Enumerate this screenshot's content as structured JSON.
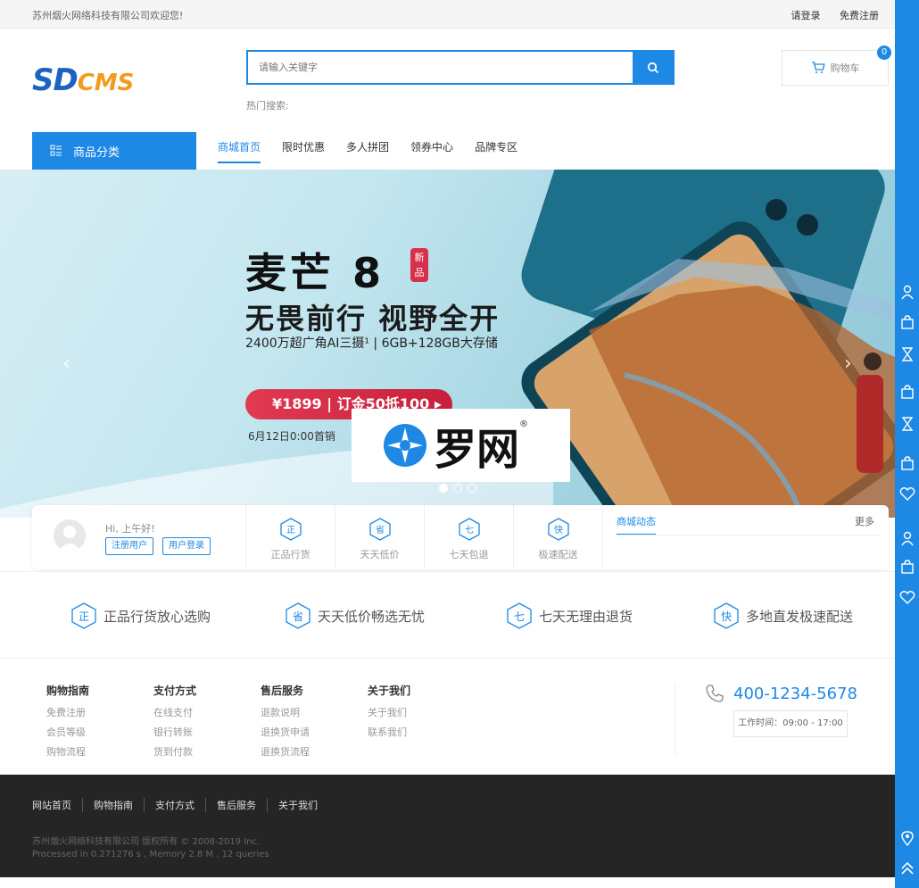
{
  "topbar": {
    "welcome": "苏州烟火网络科技有限公司欢迎您!",
    "login": "请登录",
    "register": "免费注册"
  },
  "logo": {
    "sd": "SD",
    "cms": "CMS"
  },
  "search": {
    "placeholder": "请输入关键字",
    "hot_label": "热门搜索:"
  },
  "cart": {
    "label": "购物车",
    "count": "0"
  },
  "category_button": "商品分类",
  "nav": [
    {
      "label": "商城首页",
      "active": true
    },
    {
      "label": "限时优惠"
    },
    {
      "label": "多人拼团"
    },
    {
      "label": "领券中心"
    },
    {
      "label": "品牌专区"
    }
  ],
  "banner": {
    "title": "麦芒 8",
    "new_badge": "新品",
    "subtitle": "无畏前行 视野全开",
    "spec": "2400万超广角AI三摄¹ | 6GB+128GB大存储",
    "price": "¥1899 | 订金50抵100 ▸",
    "date": "6月12日0:00首销"
  },
  "watermark": {
    "text": "罗网",
    "reg": "®"
  },
  "user_panel": {
    "greeting": "Hi, 上午好!",
    "register_btn": "注册用户",
    "login_btn": "用户登录"
  },
  "features": [
    {
      "icon": "正",
      "label": "正品行货"
    },
    {
      "icon": "省",
      "label": "天天低价"
    },
    {
      "icon": "七",
      "label": "七天包退"
    },
    {
      "icon": "快",
      "label": "极速配送"
    }
  ],
  "news": {
    "tab": "商城动态",
    "more": "更多"
  },
  "guarantees": [
    {
      "icon": "正",
      "text": "正品行货放心选购"
    },
    {
      "icon": "省",
      "text": "天天低价畅选无忧"
    },
    {
      "icon": "七",
      "text": "七天无理由退货"
    },
    {
      "icon": "快",
      "text": "多地直发极速配送"
    }
  ],
  "footer_cols": [
    {
      "title": "购物指南",
      "links": [
        "免费注册",
        "会员等级",
        "购物流程"
      ]
    },
    {
      "title": "支付方式",
      "links": [
        "在线支付",
        "银行转账",
        "货到付款"
      ]
    },
    {
      "title": "售后服务",
      "links": [
        "退款说明",
        "退换货申请",
        "退换货流程"
      ]
    },
    {
      "title": "关于我们",
      "links": [
        "关于我们",
        "联系我们"
      ]
    }
  ],
  "contact": {
    "phone": "400-1234-5678",
    "hours": "工作时间：09:00 - 17:00"
  },
  "bottom_links": [
    "网站首页",
    "购物指南",
    "支付方式",
    "售后服务",
    "关于我们"
  ],
  "copyright": "苏州烟火网络科技有限公司   版权所有 © 2008-2019 Inc.",
  "processed": "Processed in 0.271276 s , Memory 2.8 M , 12 queries",
  "colors": {
    "accent": "#1e88e5",
    "promo": "#d9304d",
    "footer": "#252525"
  }
}
